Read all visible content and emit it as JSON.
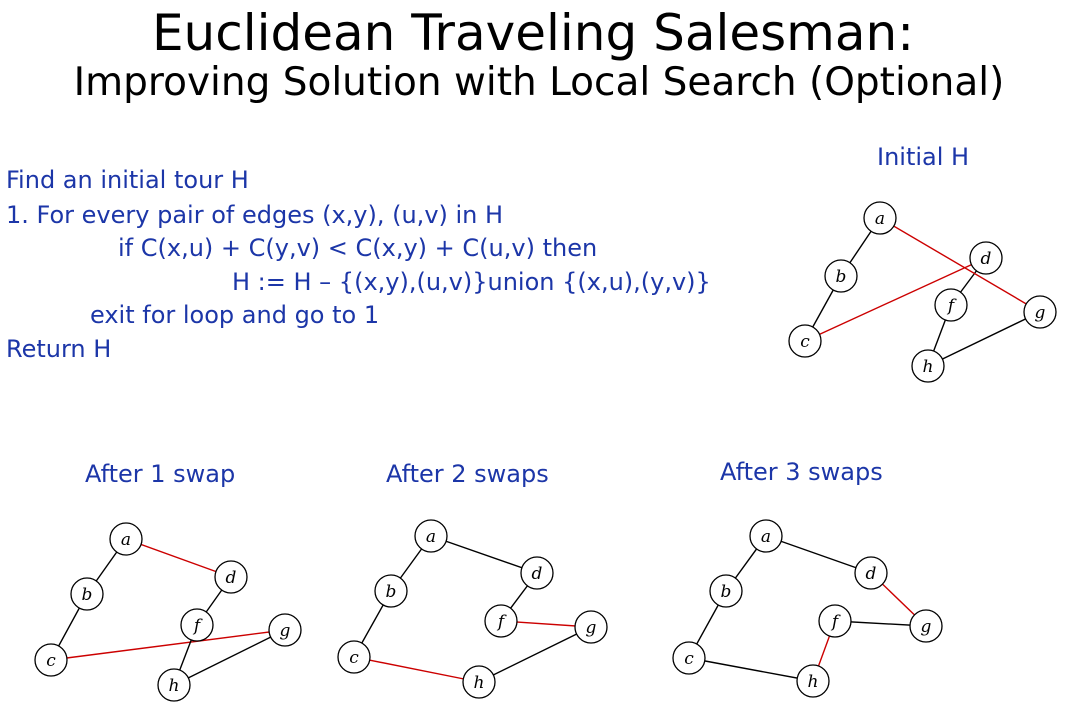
{
  "title": "Euclidean Traveling Salesman:",
  "subtitle": "Improving Solution with Local Search (Optional)",
  "colors": {
    "text_blue": "#1c36a8",
    "highlight_edge": "#cc0000",
    "edge": "#000000"
  },
  "algorithm": {
    "line1": "Find an initial tour H",
    "line2": "1. For every pair of edges (x,y), (u,v) in H",
    "line3": "if C(x,u) + C(y,v) < C(x,y) + C(u,v) then",
    "line4": "H := H – {(x,y),(u,v)}union {(x,u),(y,v)}",
    "line5": "exit for loop and go to 1",
    "line6": "Return H"
  },
  "graphs": [
    {
      "caption": "Initial H",
      "nodes": [
        "a",
        "b",
        "c",
        "d",
        "f",
        "g",
        "h"
      ],
      "edges": [
        [
          "a",
          "b"
        ],
        [
          "b",
          "c"
        ],
        [
          "c",
          "d"
        ],
        [
          "d",
          "f"
        ],
        [
          "f",
          "h"
        ],
        [
          "h",
          "g"
        ],
        [
          "g",
          "a"
        ]
      ],
      "highlighted": [
        [
          "c",
          "d"
        ],
        [
          "g",
          "a"
        ]
      ]
    },
    {
      "caption": "After 1 swap",
      "nodes": [
        "a",
        "b",
        "c",
        "d",
        "f",
        "g",
        "h"
      ],
      "edges": [
        [
          "a",
          "b"
        ],
        [
          "b",
          "c"
        ],
        [
          "c",
          "g"
        ],
        [
          "g",
          "h"
        ],
        [
          "h",
          "f"
        ],
        [
          "f",
          "d"
        ],
        [
          "d",
          "a"
        ]
      ],
      "highlighted": [
        [
          "a",
          "d"
        ],
        [
          "c",
          "g"
        ]
      ]
    },
    {
      "caption": "After 2 swaps",
      "nodes": [
        "a",
        "b",
        "c",
        "d",
        "f",
        "g",
        "h"
      ],
      "edges": [
        [
          "a",
          "b"
        ],
        [
          "b",
          "c"
        ],
        [
          "c",
          "h"
        ],
        [
          "h",
          "g"
        ],
        [
          "g",
          "f"
        ],
        [
          "f",
          "d"
        ],
        [
          "d",
          "a"
        ]
      ],
      "highlighted": [
        [
          "c",
          "h"
        ],
        [
          "f",
          "g"
        ]
      ]
    },
    {
      "caption": "After 3 swaps",
      "nodes": [
        "a",
        "b",
        "c",
        "d",
        "f",
        "g",
        "h"
      ],
      "edges": [
        [
          "a",
          "b"
        ],
        [
          "b",
          "c"
        ],
        [
          "c",
          "h"
        ],
        [
          "h",
          "f"
        ],
        [
          "f",
          "g"
        ],
        [
          "g",
          "d"
        ],
        [
          "d",
          "a"
        ]
      ],
      "highlighted": [
        [
          "f",
          "h"
        ],
        [
          "d",
          "g"
        ]
      ]
    }
  ]
}
